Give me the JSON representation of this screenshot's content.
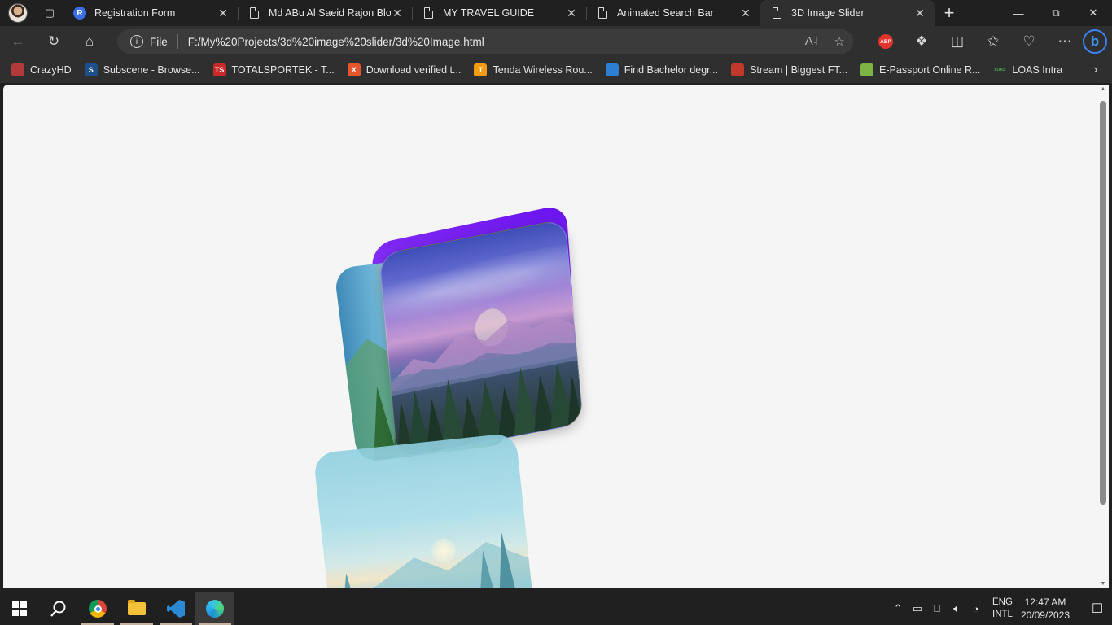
{
  "browser": {
    "tabs": [
      {
        "title": "Registration Form",
        "favicon": "r-letter-icon"
      },
      {
        "title": "Md ABu Al Saeid Rajon Blog",
        "favicon": "document-icon"
      },
      {
        "title": "MY TRAVEL GUIDE",
        "favicon": "document-icon"
      },
      {
        "title": "Animated Search Bar",
        "favicon": "document-icon"
      },
      {
        "title": "3D Image Slider",
        "favicon": "document-icon",
        "active": true
      }
    ],
    "address": {
      "scheme_label": "File",
      "url": "F:/My%20Projects/3d%20image%20slider/3d%20Image.html"
    },
    "bookmarks": [
      {
        "label": "CrazyHD",
        "icon_text": "",
        "icon_color": "#b23a3a"
      },
      {
        "label": "Subscene - Browse...",
        "icon_text": "S",
        "icon_color": "#1f4f8a"
      },
      {
        "label": "TOTALSPORTEK - T...",
        "icon_text": "TS",
        "icon_color": "#c92a2a"
      },
      {
        "label": "Download verified t...",
        "icon_text": "X",
        "icon_color": "#e4572e"
      },
      {
        "label": "Tenda Wireless Rou...",
        "icon_text": "T",
        "icon_color": "#f39c12"
      },
      {
        "label": "Find Bachelor degr...",
        "icon_text": "",
        "icon_color": "#2d7fd3"
      },
      {
        "label": "Stream | Biggest FT...",
        "icon_text": "",
        "icon_color": "#c0392b"
      },
      {
        "label": "E-Passport Online R...",
        "icon_text": "",
        "icon_color": "#7cb342"
      },
      {
        "label": "LOAS Intra",
        "icon_text": "LOAS",
        "icon_color": "#2f2f2f"
      }
    ]
  },
  "page": {
    "slider_images": [
      "lake-forest-left",
      "purple-mountain-lake",
      "teal-sunrise-forest"
    ]
  },
  "taskbar": {
    "apps": [
      "start-icon",
      "search-icon",
      "chrome-icon",
      "file-explorer-icon",
      "vscode-icon",
      "edge-icon"
    ],
    "tray": {
      "lang_top": "ENG",
      "lang_bottom": "INTL",
      "time": "12:47 AM",
      "date": "20/09/2023"
    }
  },
  "colors": {
    "chrome_bg": "#202020",
    "toolbar_bg": "#2f2f2f",
    "page_bg": "#f5f5f5",
    "accent_purple": "#6a12f0"
  }
}
